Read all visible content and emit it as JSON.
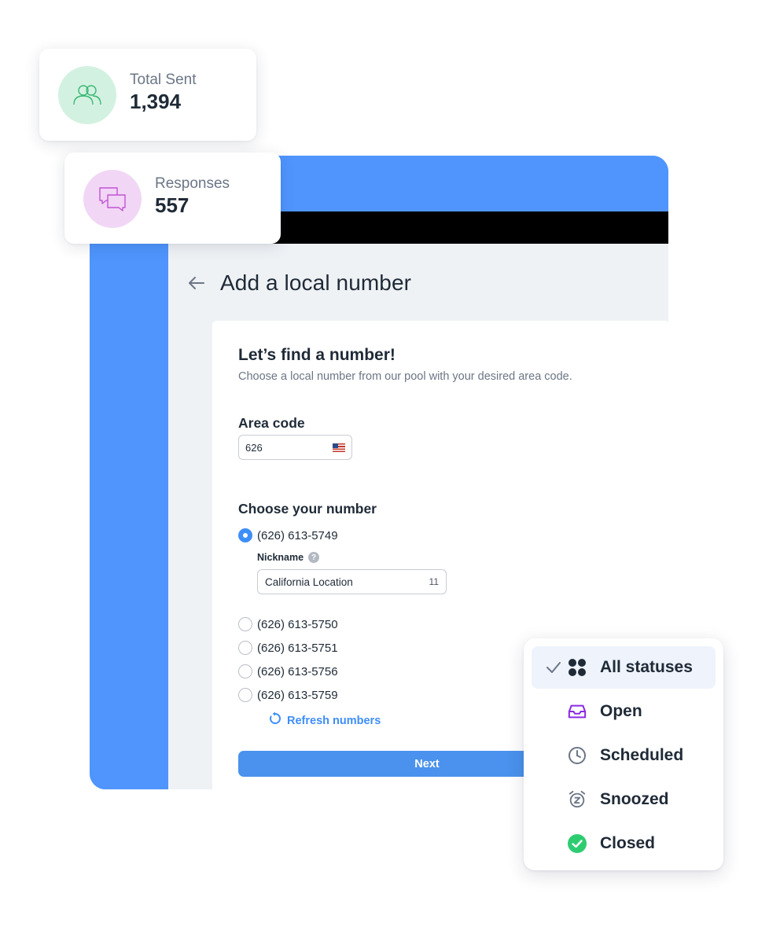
{
  "stats": {
    "total_sent": {
      "label": "Total Sent",
      "value": "1,394",
      "icon": "users-icon",
      "color": "#d3f1e1"
    },
    "responses": {
      "label": "Responses",
      "value": "557",
      "icon": "chat-bubbles-icon",
      "color": "#f1d6f5"
    }
  },
  "page": {
    "title": "Add a local number",
    "back_icon": "arrow-left-icon"
  },
  "form": {
    "title": "Let’s find a number!",
    "subtitle": "Choose a local number from our pool with your desired area code.",
    "area_code": {
      "label": "Area code",
      "value": "626",
      "flag_icon": "us-flag-icon"
    },
    "choose_label": "Choose your number",
    "numbers": [
      {
        "label": "(626) 613-5749",
        "selected": true
      },
      {
        "label": "(626) 613-5750",
        "selected": false
      },
      {
        "label": "(626) 613-5751",
        "selected": false
      },
      {
        "label": "(626) 613-5756",
        "selected": false
      },
      {
        "label": "(626) 613-5759",
        "selected": false
      }
    ],
    "nickname": {
      "label": "Nickname",
      "help": "?",
      "value": "California Location",
      "count": "11"
    },
    "refresh_label": "Refresh numbers",
    "next_label": "Next"
  },
  "status_menu": {
    "items": [
      {
        "label": "All statuses",
        "icon": "four-dots-icon",
        "selected": true
      },
      {
        "label": "Open",
        "icon": "inbox-icon",
        "selected": false
      },
      {
        "label": "Scheduled",
        "icon": "clock-icon",
        "selected": false
      },
      {
        "label": "Snoozed",
        "icon": "alarm-icon",
        "selected": false
      },
      {
        "label": "Closed",
        "icon": "check-circle-icon",
        "selected": false
      }
    ]
  },
  "colors": {
    "brand_blue": "#4f95fd",
    "accent_blue": "#3e8ef7",
    "open_purple": "#8a2be2",
    "closed_green": "#2ecc71"
  }
}
